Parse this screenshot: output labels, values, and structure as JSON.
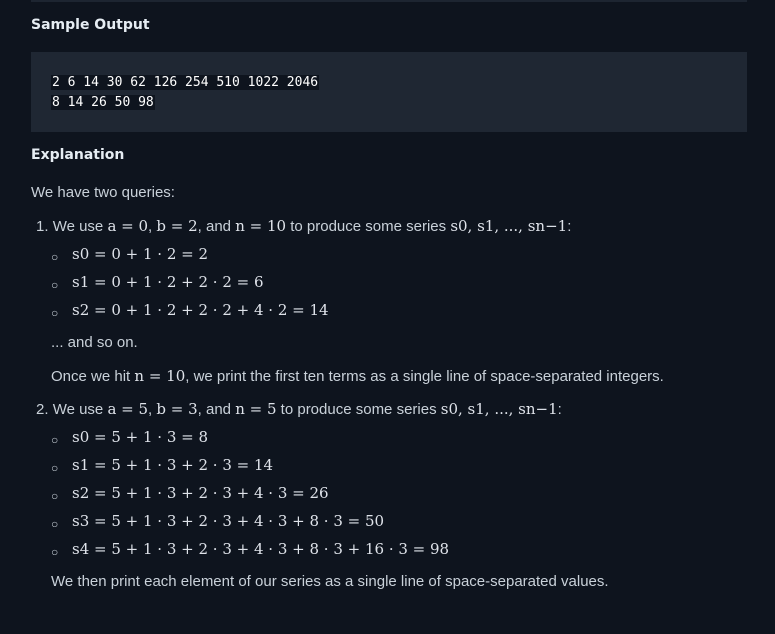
{
  "headings": {
    "sample_output": "Sample Output",
    "explanation": "Explanation"
  },
  "sample_output": {
    "line1": "2 6 14 30 62 126 254 510 1022 2046",
    "line2": "8 14 26 50 98"
  },
  "intro": "We have two queries:",
  "query1": {
    "number": "1.",
    "text_before": "We use",
    "a_eq": "a = 0",
    "b_eq": "b = 2",
    "and": ", and",
    "n_eq": "n = 10",
    "text_after": "to produce some series",
    "series": "s0, s1, ..., sn−1",
    "terms": [
      "s0 = 0 + 1 · 2 = 2",
      "s1 = 0 + 1 · 2 + 2 · 2 = 6",
      "s2 = 0 + 1 · 2 + 2 · 2 + 4 · 2 = 14"
    ],
    "and_so_on": "... and so on.",
    "once_before": "Once we hit",
    "once_n": "n = 10",
    "once_after": ", we print the first ten terms as a single line of space-separated integers."
  },
  "query2": {
    "number": "2.",
    "text_before": "We use",
    "a_eq": "a = 5",
    "b_eq": "b = 3",
    "and": ", and",
    "n_eq": "n = 5",
    "text_after": "to produce some series",
    "series": "s0, s1, ..., sn−1",
    "terms": [
      "s0 = 5 + 1 · 3 = 8",
      "s1 = 5 + 1 · 3 + 2 · 3 = 14",
      "s2 = 5 + 1 · 3 + 2 · 3 + 4 · 3 = 26",
      "s3 = 5 + 1 · 3 + 2 · 3 + 4 · 3 + 8 · 3 = 50",
      "s4 = 5 + 1 · 3 + 2 · 3 + 4 · 3 + 8 · 3 + 16 · 3 = 98"
    ],
    "closing": "We then print each element of our series as a single line of space-separated values."
  }
}
